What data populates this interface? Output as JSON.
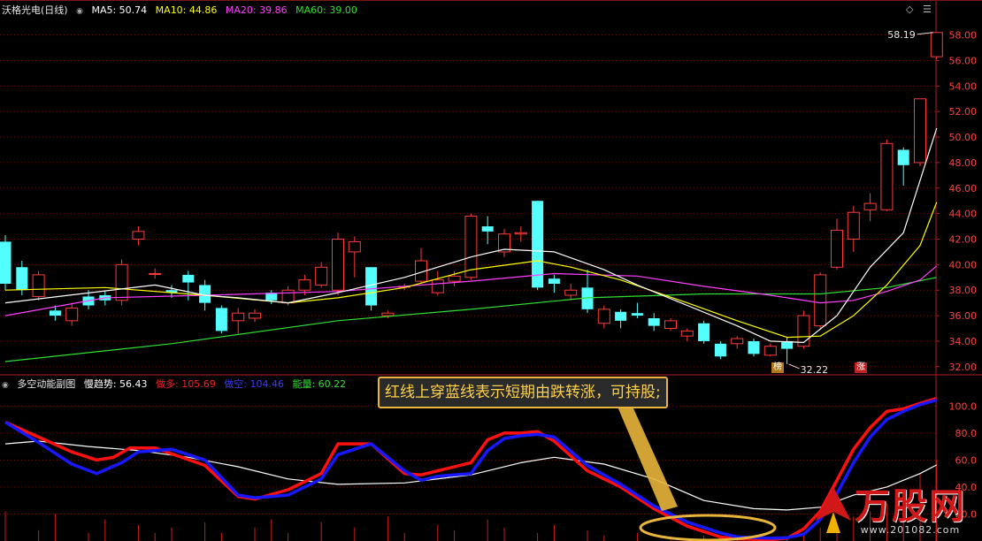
{
  "main_panel": {
    "title": "沃格光电(日线)",
    "ma5": "MA5: 50.74",
    "ma10": "MA10: 44.86",
    "ma20": "MA20: 39.86",
    "ma60": "MA60: 39.00",
    "high_label": "58.19",
    "low_label": "32.22",
    "mark_1": "榜",
    "mark_2": "涨",
    "tool_diamond": "◇",
    "tool_menu": "☰"
  },
  "sub_panel": {
    "title": "多空动能副图",
    "slow": "慢趋势: 56.43",
    "bull": "做多: 105.69",
    "bear": "做空: 104.46",
    "energy": "能量: 60.22"
  },
  "callout": {
    "text": "红线上穿蓝线表示短期由跌转涨，可持股;"
  },
  "watermark": {
    "brand": "万股网",
    "url": "www.201082.com"
  },
  "colors": {
    "up": "#ff3b3b",
    "down": "#54ffff",
    "ma5": "#ffffff",
    "ma10": "#ffff00",
    "ma20": "#ff40ff",
    "ma60": "#30e030",
    "bull": "#ff1010",
    "bear": "#1818ff",
    "slow": "#ffffff",
    "grid": "#6e1010",
    "callout": "#e8b43a"
  },
  "chart_data": [
    {
      "type": "candlestick",
      "y_axis": {
        "ticks": [
          32,
          34,
          36,
          38,
          40,
          42,
          44,
          46,
          48,
          50,
          52,
          54,
          56,
          58
        ],
        "range": [
          31.5,
          59.5
        ]
      },
      "candles": [
        [
          41.8,
          38.5,
          42.3,
          38.0
        ],
        [
          39.8,
          38.0,
          40.3,
          37.6
        ],
        [
          37.5,
          39.2,
          39.5,
          37.2
        ],
        [
          36.4,
          36.0,
          36.8,
          35.6
        ],
        [
          35.6,
          36.6,
          37.0,
          35.2
        ],
        [
          37.5,
          36.8,
          38.0,
          36.5
        ],
        [
          37.6,
          37.2,
          37.9,
          36.8
        ],
        [
          37.2,
          40.0,
          40.4,
          36.8
        ],
        [
          42.0,
          42.6,
          43.0,
          41.5
        ],
        [
          39.3,
          39.3,
          39.7,
          38.9
        ],
        [
          38.0,
          37.8,
          38.4,
          37.4
        ],
        [
          39.2,
          38.6,
          39.5,
          37.2
        ],
        [
          38.4,
          37.0,
          38.8,
          36.4
        ],
        [
          36.6,
          34.8,
          36.8,
          34.6
        ],
        [
          35.6,
          36.2,
          36.6,
          34.6
        ],
        [
          35.8,
          36.2,
          36.5,
          35.5
        ],
        [
          37.8,
          37.2,
          38.0,
          36.9
        ],
        [
          37.0,
          38.0,
          38.3,
          36.8
        ],
        [
          38.0,
          38.8,
          39.2,
          37.6
        ],
        [
          38.4,
          39.8,
          40.2,
          38.2
        ],
        [
          38.0,
          42.0,
          42.5,
          37.6
        ],
        [
          41.0,
          41.8,
          42.2,
          39.0
        ],
        [
          39.8,
          36.8,
          39.8,
          36.4
        ],
        [
          36.0,
          36.2,
          36.4,
          35.8
        ],
        [
          38.3,
          38.3,
          38.5,
          38.0
        ],
        [
          38.7,
          40.3,
          41.3,
          38.5
        ],
        [
          37.8,
          38.8,
          39.5,
          37.6
        ],
        [
          38.7,
          39.1,
          39.5,
          38.3
        ],
        [
          39.0,
          43.8,
          44.0,
          38.8
        ],
        [
          43.0,
          42.6,
          43.8,
          41.6
        ],
        [
          41.0,
          42.4,
          42.8,
          40.6
        ],
        [
          42.4,
          42.5,
          43.0,
          41.8
        ],
        [
          45.0,
          38.2,
          45.0,
          38.0
        ],
        [
          38.9,
          38.5,
          39.2,
          37.8
        ],
        [
          37.6,
          38.0,
          38.5,
          37.2
        ],
        [
          38.2,
          36.5,
          39.6,
          36.2
        ],
        [
          35.4,
          36.5,
          36.8,
          35.0
        ],
        [
          36.3,
          35.6,
          36.5,
          35.0
        ],
        [
          36.2,
          36.0,
          37.0,
          35.8
        ],
        [
          35.8,
          35.2,
          36.2,
          34.8
        ],
        [
          35.0,
          35.6,
          35.8,
          34.8
        ],
        [
          34.4,
          34.8,
          35.0,
          34.0
        ],
        [
          35.4,
          34.0,
          35.6,
          33.8
        ],
        [
          33.8,
          32.8,
          34.0,
          32.6
        ],
        [
          33.8,
          34.2,
          34.4,
          33.4
        ],
        [
          34.0,
          33.0,
          34.2,
          32.8
        ],
        [
          32.9,
          33.6,
          33.8,
          32.8
        ],
        [
          34.0,
          33.4,
          34.3,
          32.2
        ],
        [
          33.6,
          36.0,
          36.4,
          33.4
        ],
        [
          35.2,
          39.2,
          39.4,
          35.0
        ],
        [
          39.8,
          42.7,
          43.6,
          39.6
        ],
        [
          42.0,
          44.1,
          44.6,
          41.0
        ],
        [
          44.3,
          44.8,
          45.6,
          43.4
        ],
        [
          44.3,
          49.5,
          49.8,
          44.2
        ],
        [
          49.0,
          47.8,
          49.2,
          46.2
        ],
        [
          48.0,
          53.0,
          53.0,
          47.7
        ],
        [
          56.3,
          58.2,
          58.2,
          56.1
        ]
      ],
      "ma5": [
        [
          0,
          37.0
        ],
        [
          9,
          38.4
        ],
        [
          12,
          37.6
        ],
        [
          14,
          37.4
        ],
        [
          17,
          37.0
        ],
        [
          20,
          37.8
        ],
        [
          24,
          39.0
        ],
        [
          28,
          40.6
        ],
        [
          30,
          41.2
        ],
        [
          33,
          41.0
        ],
        [
          36,
          39.6
        ],
        [
          38,
          38.4
        ],
        [
          41,
          36.8
        ],
        [
          44,
          35.2
        ],
        [
          46,
          34.0
        ],
        [
          48,
          33.9
        ],
        [
          50,
          36.0
        ],
        [
          52,
          39.8
        ],
        [
          54,
          42.5
        ],
        [
          56,
          50.7
        ]
      ],
      "ma10": [
        [
          0,
          38.0
        ],
        [
          6,
          38.2
        ],
        [
          12,
          37.6
        ],
        [
          17,
          37.0
        ],
        [
          20,
          37.4
        ],
        [
          24,
          38.2
        ],
        [
          28,
          39.6
        ],
        [
          32,
          40.3
        ],
        [
          34,
          39.8
        ],
        [
          37,
          38.8
        ],
        [
          41,
          37.0
        ],
        [
          44,
          35.6
        ],
        [
          47,
          34.3
        ],
        [
          49,
          34.4
        ],
        [
          51,
          36.0
        ],
        [
          53,
          38.4
        ],
        [
          55,
          41.5
        ],
        [
          56,
          44.9
        ]
      ],
      "ma20": [
        [
          0,
          36.0
        ],
        [
          6,
          37.4
        ],
        [
          12,
          37.6
        ],
        [
          20,
          37.9
        ],
        [
          28,
          38.7
        ],
        [
          33,
          39.3
        ],
        [
          38,
          39.1
        ],
        [
          42,
          38.3
        ],
        [
          46,
          37.6
        ],
        [
          49,
          37.0
        ],
        [
          51,
          37.2
        ],
        [
          53,
          37.9
        ],
        [
          55,
          38.8
        ],
        [
          56,
          39.9
        ]
      ],
      "ma60": [
        [
          0,
          32.4
        ],
        [
          10,
          33.8
        ],
        [
          20,
          35.6
        ],
        [
          28,
          36.5
        ],
        [
          35,
          37.4
        ],
        [
          42,
          37.7
        ],
        [
          49,
          37.7
        ],
        [
          53,
          38.2
        ],
        [
          56,
          39.0
        ]
      ]
    },
    {
      "type": "line",
      "y_axis": {
        "ticks": [
          20,
          40,
          60,
          80,
          100
        ],
        "range": [
          0,
          112
        ]
      },
      "bull": [
        [
          0,
          88
        ],
        [
          4,
          66
        ],
        [
          5.5,
          60
        ],
        [
          6.5,
          62
        ],
        [
          7.5,
          69
        ],
        [
          9,
          69
        ],
        [
          12,
          56
        ],
        [
          14,
          33
        ],
        [
          15,
          31
        ],
        [
          17,
          38
        ],
        [
          19,
          50
        ],
        [
          20,
          72
        ],
        [
          22,
          72
        ],
        [
          24,
          50
        ],
        [
          25,
          49
        ],
        [
          26,
          52
        ],
        [
          28,
          58
        ],
        [
          29,
          75
        ],
        [
          30,
          80
        ],
        [
          31,
          80
        ],
        [
          32,
          81
        ],
        [
          33,
          74
        ],
        [
          35,
          52
        ],
        [
          37,
          40
        ],
        [
          39,
          24
        ],
        [
          41,
          11
        ],
        [
          43,
          3
        ],
        [
          44,
          1.5
        ],
        [
          46,
          1
        ],
        [
          47,
          2
        ],
        [
          48,
          9
        ],
        [
          49,
          22
        ],
        [
          50,
          45
        ],
        [
          51,
          68
        ],
        [
          52,
          84
        ],
        [
          53,
          96
        ],
        [
          54,
          98
        ],
        [
          55,
          102
        ],
        [
          56,
          105.7
        ]
      ],
      "bear": [
        [
          0,
          88
        ],
        [
          2,
          73
        ],
        [
          4,
          57
        ],
        [
          5.5,
          50
        ],
        [
          7,
          58
        ],
        [
          8,
          66
        ],
        [
          10,
          68
        ],
        [
          12,
          60
        ],
        [
          14,
          34
        ],
        [
          15,
          32
        ],
        [
          17,
          34
        ],
        [
          19,
          46
        ],
        [
          20,
          64
        ],
        [
          22,
          72
        ],
        [
          24,
          52
        ],
        [
          25,
          45
        ],
        [
          26,
          48
        ],
        [
          28,
          50
        ],
        [
          29,
          67
        ],
        [
          30,
          76
        ],
        [
          31,
          78
        ],
        [
          32,
          79
        ],
        [
          33,
          77
        ],
        [
          35,
          56
        ],
        [
          37,
          42
        ],
        [
          39,
          26
        ],
        [
          41,
          14
        ],
        [
          43,
          6
        ],
        [
          44,
          3
        ],
        [
          46,
          2
        ],
        [
          47,
          2.5
        ],
        [
          48,
          5
        ],
        [
          49,
          16
        ],
        [
          50,
          35
        ],
        [
          51,
          58
        ],
        [
          52,
          77
        ],
        [
          53,
          90
        ],
        [
          54,
          96
        ],
        [
          55,
          101
        ],
        [
          56,
          104.5
        ]
      ],
      "slow": [
        [
          0,
          72
        ],
        [
          2,
          74
        ],
        [
          5,
          70
        ],
        [
          8,
          67
        ],
        [
          11,
          62
        ],
        [
          14,
          55
        ],
        [
          17,
          46
        ],
        [
          20,
          42
        ],
        [
          24,
          43
        ],
        [
          28,
          49
        ],
        [
          31,
          58
        ],
        [
          33,
          62
        ],
        [
          36,
          57
        ],
        [
          39,
          46
        ],
        [
          42,
          30
        ],
        [
          45,
          24
        ],
        [
          47,
          23
        ],
        [
          49,
          25
        ],
        [
          51,
          34
        ],
        [
          53,
          40
        ],
        [
          55,
          50
        ],
        [
          56,
          56.4
        ]
      ],
      "energy_bars": [
        [
          0,
          22
        ],
        [
          2,
          8
        ],
        [
          3,
          20
        ],
        [
          5,
          6
        ],
        [
          6,
          16
        ],
        [
          8,
          12
        ],
        [
          9,
          6
        ],
        [
          10,
          10
        ],
        [
          12,
          14
        ],
        [
          13,
          6
        ],
        [
          15,
          10
        ],
        [
          16,
          16
        ],
        [
          17,
          6
        ],
        [
          19,
          14
        ],
        [
          21,
          10
        ],
        [
          23,
          18
        ],
        [
          24,
          6
        ],
        [
          26,
          12
        ],
        [
          27,
          8
        ],
        [
          29,
          16
        ],
        [
          30,
          10
        ],
        [
          32,
          6
        ],
        [
          33,
          12
        ],
        [
          35,
          8
        ],
        [
          36,
          4
        ],
        [
          38,
          6
        ],
        [
          40,
          3
        ],
        [
          42,
          4
        ],
        [
          43,
          2
        ],
        [
          44,
          3
        ],
        [
          45,
          2
        ],
        [
          46,
          2
        ],
        [
          47,
          3
        ],
        [
          48,
          6
        ],
        [
          49,
          10
        ],
        [
          50,
          14
        ],
        [
          51,
          18
        ],
        [
          52,
          22
        ],
        [
          53,
          28
        ],
        [
          54,
          38
        ],
        [
          55,
          50
        ],
        [
          56,
          60.2
        ]
      ]
    }
  ]
}
